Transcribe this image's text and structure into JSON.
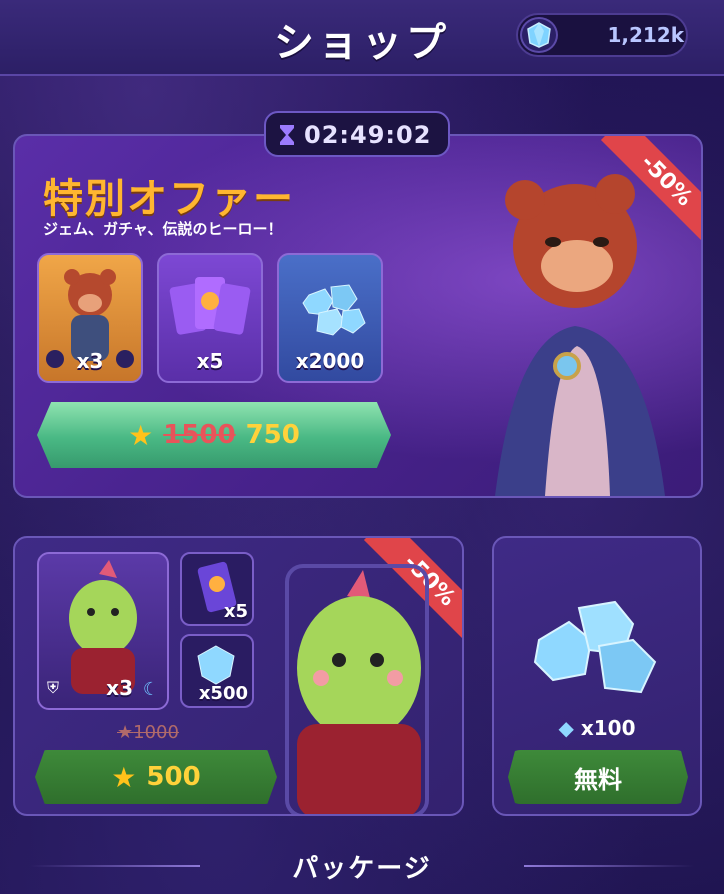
{
  "header": {
    "title": "ショップ",
    "currency_value": "1,212k",
    "currency_icon": "gem-icon"
  },
  "timer": {
    "value": "02:49:02",
    "icon": "hourglass-icon"
  },
  "special_offer": {
    "title": "特別オファー",
    "subtitle": "ジェム、ガチャ、伝説のヒーロー！",
    "discount": "-50%",
    "items": [
      {
        "name": "hero-bear-card",
        "qty": "x3"
      },
      {
        "name": "gacha-packs",
        "qty": "x5"
      },
      {
        "name": "gem-pile",
        "qty": "x2000"
      }
    ],
    "old_price": "1500",
    "new_price": "750"
  },
  "package_offer": {
    "discount": "-50%",
    "hero_qty": "x3",
    "pack_qty": "x5",
    "gem_qty": "x500",
    "old_price": "1000",
    "new_price": "500"
  },
  "free_gems": {
    "qty": "x100",
    "button_label": "無料"
  },
  "section": {
    "title": "パッケージ"
  },
  "colors": {
    "accent_orange": "#ffb630",
    "discount_red": "#e0454a",
    "buy_green": "#49b884",
    "price_gold": "#ffd23a"
  }
}
